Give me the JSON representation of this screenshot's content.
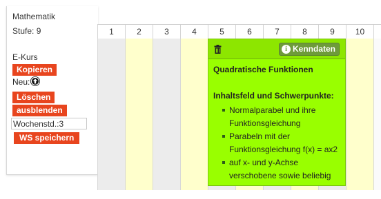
{
  "sidebar": {
    "subject": "Mathematik",
    "stufe": "Stufe: 9",
    "kurs": "E-Kurs",
    "kopieren_label": "Kopieren",
    "neu_label": "Neu:",
    "loeschen_label": "Löschen",
    "ausblenden_label": "ausblenden",
    "wochenstd_value": "Wochenstd.:3",
    "ws_speichern_label": "WS speichern"
  },
  "weeks": [
    "1",
    "2",
    "3",
    "4",
    "5",
    "6",
    "7",
    "8",
    "9",
    "10"
  ],
  "card": {
    "kenndaten_label": "Kenndaten",
    "title": "Quadratische Funktionen",
    "section_title": "Inhaltsfeld und Schwerpunkte:",
    "lines": [
      "Normalparabel und ihre",
      "Funktionsgleichung",
      "Parabeln mit der",
      "Funktionsgleichung f(x) = ax2",
      "auf x- und y-Achse",
      "verschobene sowie beliebig"
    ],
    "color": "#99ff00"
  },
  "colors": {
    "button_red": "#e8451e",
    "column_yellow": "#ffffcc",
    "column_grey": "#ececec"
  }
}
